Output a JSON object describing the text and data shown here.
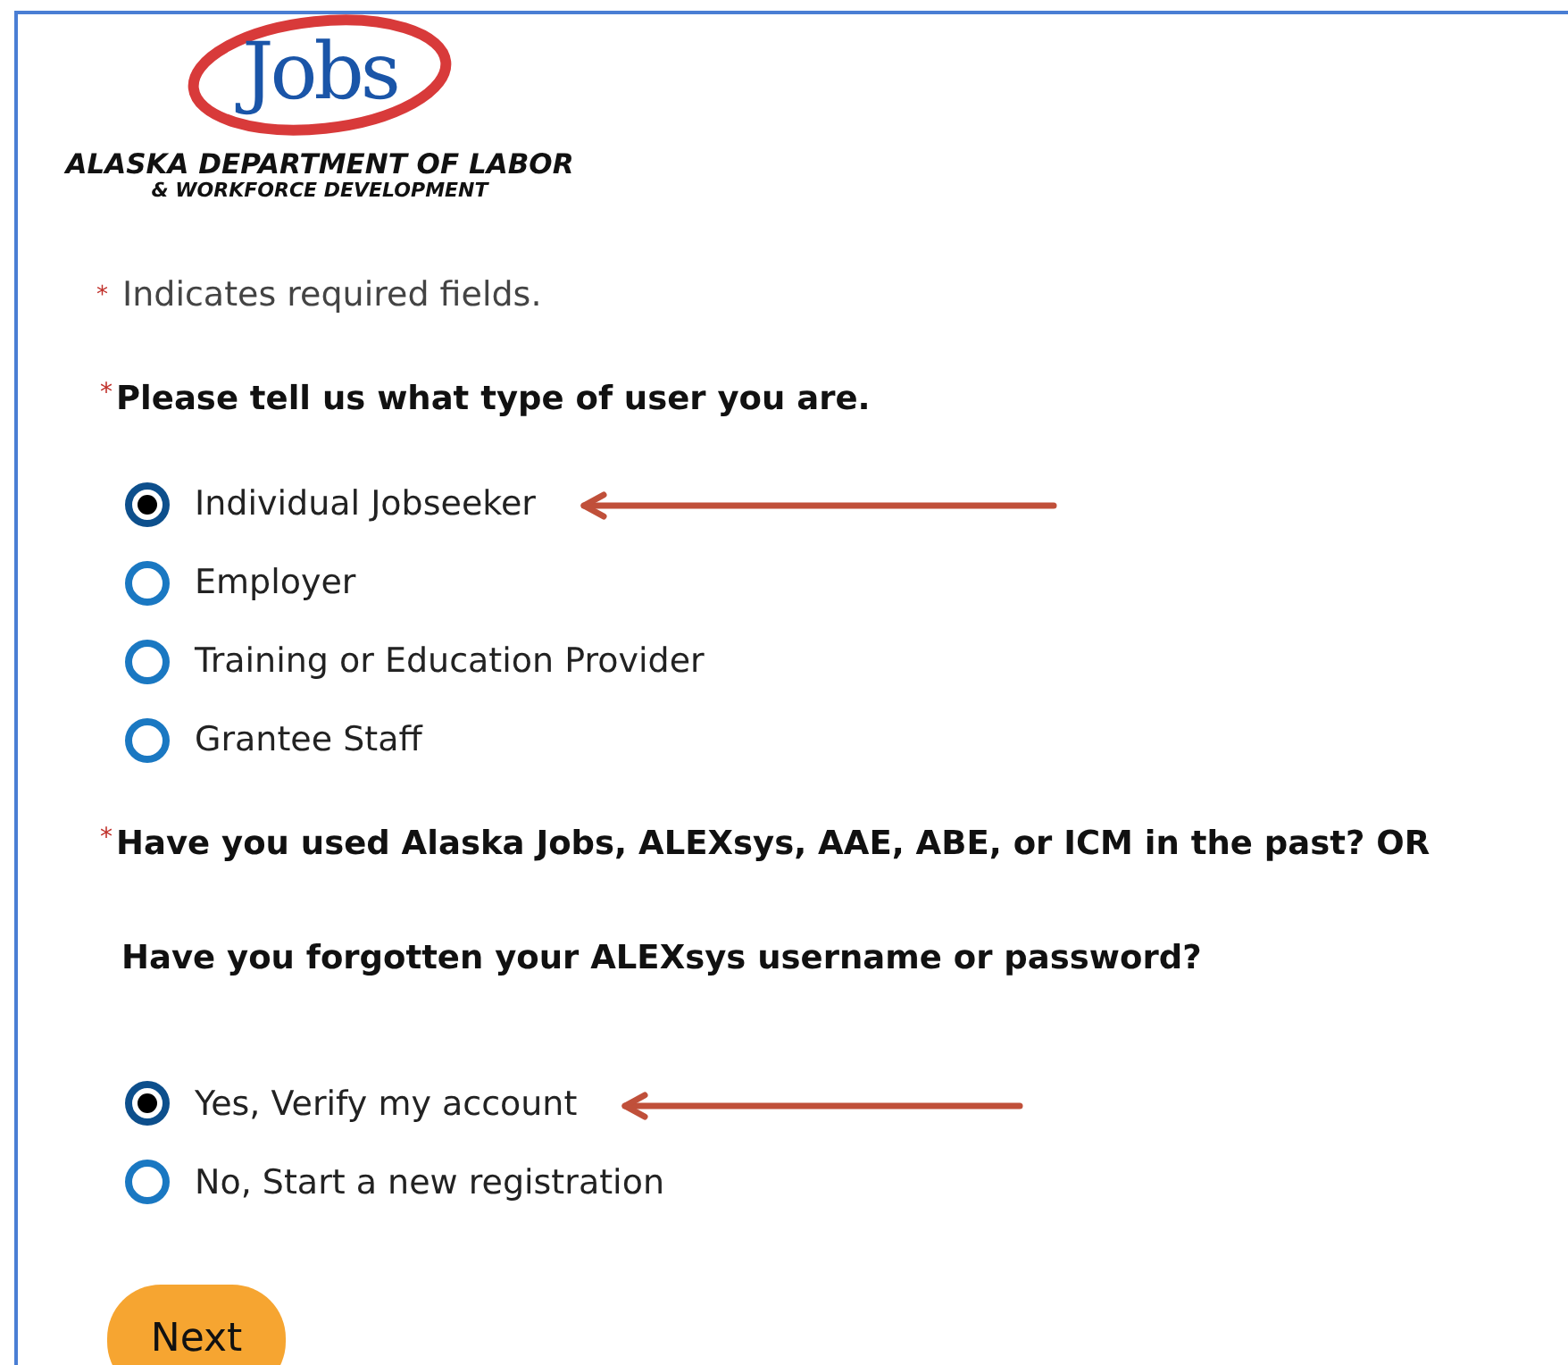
{
  "logo": {
    "wordmark": "Jobs",
    "line_1": "ALASKA DEPARTMENT OF LABOR",
    "line_2": "& WORKFORCE DEVELOPMENT"
  },
  "legend": {
    "mark": "*",
    "text": "Indicates required fields."
  },
  "questions": [
    {
      "mark": "*",
      "lines": [
        "Please tell us what type of user you are."
      ],
      "options": [
        {
          "label": "Individual Jobseeker",
          "selected": true,
          "arrow": true
        },
        {
          "label": "Employer",
          "selected": false,
          "arrow": false
        },
        {
          "label": "Training or Education Provider",
          "selected": false,
          "arrow": false
        },
        {
          "label": "Grantee Staff",
          "selected": false,
          "arrow": false
        }
      ]
    },
    {
      "mark": "*",
      "lines": [
        "Have you used Alaska Jobs, ALEXsys, AAE, ABE, or ICM in the past? OR",
        "Have you forgotten your ALEXsys username or password?"
      ],
      "options": [
        {
          "label": "Yes, Verify my account",
          "selected": true,
          "arrow": true
        },
        {
          "label": "No, Start a new registration",
          "selected": false,
          "arrow": false
        }
      ]
    }
  ],
  "next_button": "Next"
}
